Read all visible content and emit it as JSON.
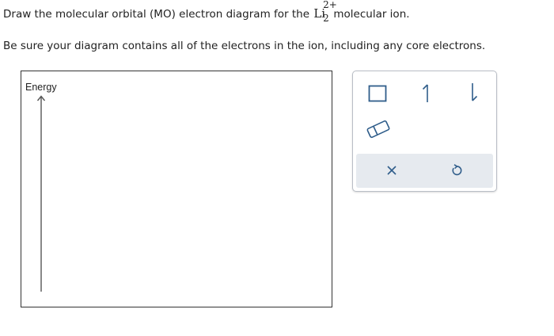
{
  "question": {
    "line1_before": "Draw the molecular orbital (MO) electron diagram for the ",
    "formula_base": "Li",
    "formula_subscript": "2",
    "formula_superscript": "2+",
    "line1_after": " molecular ion.",
    "line2": "Be sure your diagram contains all of the electrons in the ion, including any core electrons."
  },
  "canvas": {
    "axis_label": "Energy"
  },
  "toolbox": {
    "tools": [
      {
        "name": "orbital-box",
        "icon": "square-icon"
      },
      {
        "name": "electron-spin-up",
        "icon": "half-arrow-up-icon"
      },
      {
        "name": "electron-spin-down",
        "icon": "half-arrow-down-icon"
      },
      {
        "name": "eraser",
        "icon": "eraser-icon"
      }
    ],
    "footer": [
      {
        "name": "clear",
        "icon": "close-icon"
      },
      {
        "name": "undo",
        "icon": "undo-icon"
      }
    ],
    "colors": {
      "accent": "#2f5d8a",
      "footer_bg": "#e6eaef",
      "border": "#b9bec6"
    }
  }
}
